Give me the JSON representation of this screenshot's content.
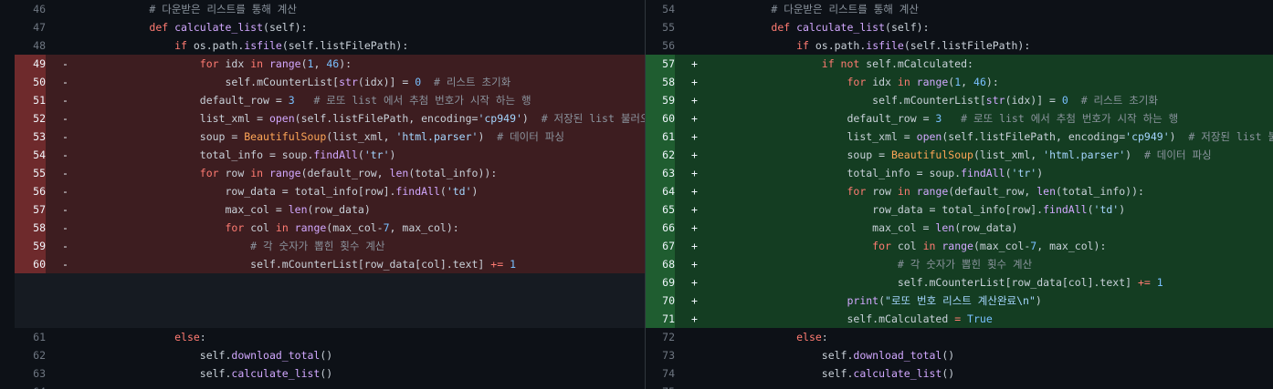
{
  "left": {
    "context_top": [
      {
        "num": "46",
        "code": [
          {
            "t": "        "
          },
          {
            "t": "# 다운받은 리스트를 통해 계산",
            "c": "cm"
          }
        ]
      },
      {
        "num": "47",
        "code": [
          {
            "t": "        "
          },
          {
            "t": "def ",
            "c": "kw"
          },
          {
            "t": "calculate_list",
            "c": "fn"
          },
          {
            "t": "(self):"
          }
        ]
      },
      {
        "num": "48",
        "code": [
          {
            "t": "            "
          },
          {
            "t": "if ",
            "c": "kw"
          },
          {
            "t": "os.path."
          },
          {
            "t": "isfile",
            "c": "fn"
          },
          {
            "t": "(self.listFilePath):"
          }
        ]
      }
    ],
    "deleted": [
      {
        "num": "49",
        "code": [
          {
            "t": "                "
          },
          {
            "t": "for ",
            "c": "kw"
          },
          {
            "t": "idx "
          },
          {
            "t": "in ",
            "c": "kw"
          },
          {
            "t": "range",
            "c": "fn"
          },
          {
            "t": "("
          },
          {
            "t": "1",
            "c": "nm"
          },
          {
            "t": ", "
          },
          {
            "t": "46",
            "c": "nm"
          },
          {
            "t": "):"
          }
        ]
      },
      {
        "num": "50",
        "code": [
          {
            "t": "                    "
          },
          {
            "t": "self.mCounterList["
          },
          {
            "t": "str",
            "c": "fn"
          },
          {
            "t": "(idx)] = "
          },
          {
            "t": "0",
            "c": "nm"
          },
          {
            "t": "  "
          },
          {
            "t": "# 리스트 초기화",
            "c": "cm"
          }
        ]
      },
      {
        "num": "51",
        "code": [
          {
            "t": "                "
          },
          {
            "t": "default_row = "
          },
          {
            "t": "3",
            "c": "nm"
          },
          {
            "t": "   "
          },
          {
            "t": "# 로또 list 에서 추첨 번호가 시작 하는 행",
            "c": "cm"
          }
        ]
      },
      {
        "num": "52",
        "code": [
          {
            "t": "                "
          },
          {
            "t": "list_xml = "
          },
          {
            "t": "open",
            "c": "fn"
          },
          {
            "t": "(self.listFilePath, encoding="
          },
          {
            "t": "'cp949'",
            "c": "st"
          },
          {
            "t": ")  "
          },
          {
            "t": "# 저장된 list 불러오기",
            "c": "cm"
          }
        ]
      },
      {
        "num": "53",
        "code": [
          {
            "t": "                "
          },
          {
            "t": "soup = "
          },
          {
            "t": "BeautifulSoup",
            "c": "bi"
          },
          {
            "t": "(list_xml, "
          },
          {
            "t": "'html.parser'",
            "c": "st"
          },
          {
            "t": ")  "
          },
          {
            "t": "# 데이터 파싱",
            "c": "cm"
          }
        ]
      },
      {
        "num": "54",
        "code": [
          {
            "t": "                "
          },
          {
            "t": "total_info = soup."
          },
          {
            "t": "findAll",
            "c": "fn"
          },
          {
            "t": "("
          },
          {
            "t": "'tr'",
            "c": "st"
          },
          {
            "t": ")"
          }
        ]
      },
      {
        "num": "55",
        "code": [
          {
            "t": "                "
          },
          {
            "t": "for ",
            "c": "kw"
          },
          {
            "t": "row "
          },
          {
            "t": "in ",
            "c": "kw"
          },
          {
            "t": "range",
            "c": "fn"
          },
          {
            "t": "(default_row, "
          },
          {
            "t": "len",
            "c": "fn"
          },
          {
            "t": "(total_info)):"
          }
        ]
      },
      {
        "num": "56",
        "code": [
          {
            "t": "                    "
          },
          {
            "t": "row_data = total_info[row]."
          },
          {
            "t": "findAll",
            "c": "fn"
          },
          {
            "t": "("
          },
          {
            "t": "'td'",
            "c": "st"
          },
          {
            "t": ")"
          }
        ]
      },
      {
        "num": "57",
        "code": [
          {
            "t": "                    "
          },
          {
            "t": "max_col = "
          },
          {
            "t": "len",
            "c": "fn"
          },
          {
            "t": "(row_data)"
          }
        ]
      },
      {
        "num": "58",
        "code": [
          {
            "t": "                    "
          },
          {
            "t": "for ",
            "c": "kw"
          },
          {
            "t": "col "
          },
          {
            "t": "in ",
            "c": "kw"
          },
          {
            "t": "range",
            "c": "fn"
          },
          {
            "t": "(max_col-"
          },
          {
            "t": "7",
            "c": "nm"
          },
          {
            "t": ", max_col):"
          }
        ]
      },
      {
        "num": "59",
        "code": [
          {
            "t": "                        "
          },
          {
            "t": "# 각 숫자가 뽑힌 횟수 계산",
            "c": "cm"
          }
        ]
      },
      {
        "num": "60",
        "code": [
          {
            "t": "                        "
          },
          {
            "t": "self.mCounterList[row_data[col].text] "
          },
          {
            "t": "+= ",
            "c": "kw"
          },
          {
            "t": "1",
            "c": "nm"
          }
        ]
      }
    ],
    "context_bottom": [
      {
        "num": "61",
        "code": [
          {
            "t": "            "
          },
          {
            "t": "else",
            "c": "kw"
          },
          {
            "t": ":"
          }
        ]
      },
      {
        "num": "62",
        "code": [
          {
            "t": "                "
          },
          {
            "t": "self."
          },
          {
            "t": "download_total",
            "c": "fn"
          },
          {
            "t": "()"
          }
        ]
      },
      {
        "num": "63",
        "code": [
          {
            "t": "                "
          },
          {
            "t": "self."
          },
          {
            "t": "calculate_list",
            "c": "fn"
          },
          {
            "t": "()"
          }
        ]
      },
      {
        "num": "64",
        "code": [
          {
            "t": ""
          }
        ]
      }
    ]
  },
  "right": {
    "context_top": [
      {
        "num": "54",
        "code": [
          {
            "t": "        "
          },
          {
            "t": "# 다운받은 리스트를 통해 계산",
            "c": "cm"
          }
        ]
      },
      {
        "num": "55",
        "code": [
          {
            "t": "        "
          },
          {
            "t": "def ",
            "c": "kw"
          },
          {
            "t": "calculate_list",
            "c": "fn"
          },
          {
            "t": "(self):"
          }
        ]
      },
      {
        "num": "56",
        "code": [
          {
            "t": "            "
          },
          {
            "t": "if ",
            "c": "kw"
          },
          {
            "t": "os.path."
          },
          {
            "t": "isfile",
            "c": "fn"
          },
          {
            "t": "(self.listFilePath):"
          }
        ]
      }
    ],
    "added": [
      {
        "num": "57",
        "code": [
          {
            "t": "                "
          },
          {
            "t": "if not ",
            "c": "kw"
          },
          {
            "t": "self.mCalculated:"
          }
        ]
      },
      {
        "num": "58",
        "code": [
          {
            "t": "                    "
          },
          {
            "t": "for ",
            "c": "kw"
          },
          {
            "t": "idx "
          },
          {
            "t": "in ",
            "c": "kw"
          },
          {
            "t": "range",
            "c": "fn"
          },
          {
            "t": "("
          },
          {
            "t": "1",
            "c": "nm"
          },
          {
            "t": ", "
          },
          {
            "t": "46",
            "c": "nm"
          },
          {
            "t": "):"
          }
        ]
      },
      {
        "num": "59",
        "code": [
          {
            "t": "                        "
          },
          {
            "t": "self.mCounterList["
          },
          {
            "t": "str",
            "c": "fn"
          },
          {
            "t": "(idx)] = "
          },
          {
            "t": "0",
            "c": "nm"
          },
          {
            "t": "  "
          },
          {
            "t": "# 리스트 초기화",
            "c": "cm"
          }
        ]
      },
      {
        "num": "60",
        "code": [
          {
            "t": "                    "
          },
          {
            "t": "default_row = "
          },
          {
            "t": "3",
            "c": "nm"
          },
          {
            "t": "   "
          },
          {
            "t": "# 로또 list 에서 추첨 번호가 시작 하는 행",
            "c": "cm"
          }
        ]
      },
      {
        "num": "61",
        "code": [
          {
            "t": "                    "
          },
          {
            "t": "list_xml = "
          },
          {
            "t": "open",
            "c": "fn"
          },
          {
            "t": "(self.listFilePath, encoding="
          },
          {
            "t": "'cp949'",
            "c": "st"
          },
          {
            "t": ")  "
          },
          {
            "t": "# 저장된 list 불러오기",
            "c": "cm"
          }
        ]
      },
      {
        "num": "62",
        "code": [
          {
            "t": "                    "
          },
          {
            "t": "soup = "
          },
          {
            "t": "BeautifulSoup",
            "c": "bi"
          },
          {
            "t": "(list_xml, "
          },
          {
            "t": "'html.parser'",
            "c": "st"
          },
          {
            "t": ")  "
          },
          {
            "t": "# 데이터 파싱",
            "c": "cm"
          }
        ]
      },
      {
        "num": "63",
        "code": [
          {
            "t": "                    "
          },
          {
            "t": "total_info = soup."
          },
          {
            "t": "findAll",
            "c": "fn"
          },
          {
            "t": "("
          },
          {
            "t": "'tr'",
            "c": "st"
          },
          {
            "t": ")"
          }
        ]
      },
      {
        "num": "64",
        "code": [
          {
            "t": "                    "
          },
          {
            "t": "for ",
            "c": "kw"
          },
          {
            "t": "row "
          },
          {
            "t": "in ",
            "c": "kw"
          },
          {
            "t": "range",
            "c": "fn"
          },
          {
            "t": "(default_row, "
          },
          {
            "t": "len",
            "c": "fn"
          },
          {
            "t": "(total_info)):"
          }
        ]
      },
      {
        "num": "65",
        "code": [
          {
            "t": "                        "
          },
          {
            "t": "row_data = total_info[row]."
          },
          {
            "t": "findAll",
            "c": "fn"
          },
          {
            "t": "("
          },
          {
            "t": "'td'",
            "c": "st"
          },
          {
            "t": ")"
          }
        ]
      },
      {
        "num": "66",
        "code": [
          {
            "t": "                        "
          },
          {
            "t": "max_col = "
          },
          {
            "t": "len",
            "c": "fn"
          },
          {
            "t": "(row_data)"
          }
        ]
      },
      {
        "num": "67",
        "code": [
          {
            "t": "                        "
          },
          {
            "t": "for ",
            "c": "kw"
          },
          {
            "t": "col "
          },
          {
            "t": "in ",
            "c": "kw"
          },
          {
            "t": "range",
            "c": "fn"
          },
          {
            "t": "(max_col-"
          },
          {
            "t": "7",
            "c": "nm"
          },
          {
            "t": ", max_col):"
          }
        ]
      },
      {
        "num": "68",
        "code": [
          {
            "t": "                            "
          },
          {
            "t": "# 각 숫자가 뽑힌 횟수 계산",
            "c": "cm"
          }
        ]
      },
      {
        "num": "69",
        "code": [
          {
            "t": "                            "
          },
          {
            "t": "self.mCounterList[row_data[col].text] "
          },
          {
            "t": "+= ",
            "c": "kw"
          },
          {
            "t": "1",
            "c": "nm"
          }
        ]
      },
      {
        "num": "70",
        "code": [
          {
            "t": "                    "
          },
          {
            "t": "print",
            "c": "fn"
          },
          {
            "t": "("
          },
          {
            "t": "\"로또 번호 리스트 계산완료\\n\"",
            "c": "st"
          },
          {
            "t": ")"
          }
        ]
      },
      {
        "num": "71",
        "code": [
          {
            "t": "                    "
          },
          {
            "t": "self.mCalculated "
          },
          {
            "t": "= ",
            "c": "kw"
          },
          {
            "t": "True",
            "c": "nm"
          }
        ]
      }
    ],
    "context_bottom": [
      {
        "num": "72",
        "code": [
          {
            "t": "            "
          },
          {
            "t": "else",
            "c": "kw"
          },
          {
            "t": ":"
          }
        ]
      },
      {
        "num": "73",
        "code": [
          {
            "t": "                "
          },
          {
            "t": "self."
          },
          {
            "t": "download_total",
            "c": "fn"
          },
          {
            "t": "()"
          }
        ]
      },
      {
        "num": "74",
        "code": [
          {
            "t": "                "
          },
          {
            "t": "self."
          },
          {
            "t": "calculate_list",
            "c": "fn"
          },
          {
            "t": "()"
          }
        ]
      },
      {
        "num": "75",
        "code": [
          {
            "t": ""
          }
        ]
      }
    ]
  },
  "markers": {
    "deleted": "-",
    "added": "+"
  },
  "colors": {
    "background": "#0d1117",
    "deleted_row": "#3d1d20",
    "deleted_gutter": "#6e2a2c",
    "added_row": "#143d22",
    "added_gutter": "#1f5d30",
    "keyword": "#ff7b72",
    "function": "#d2a8ff",
    "string": "#a5d6ff",
    "number": "#79c0ff",
    "comment": "#8b949e",
    "class": "#ffa657"
  }
}
